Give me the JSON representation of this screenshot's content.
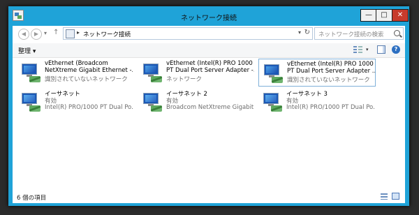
{
  "window": {
    "title": "ネットワーク接続",
    "min_label": "—",
    "max_label": "□",
    "close_label": "✕"
  },
  "nav": {
    "back_label": "◀",
    "forward_label": "▶",
    "recent_label": "▾",
    "up_label": "↑",
    "address_sep": "▸",
    "address": "ネットワーク接続",
    "address_dropdown": "▾",
    "refresh_label": "↻",
    "search_placeholder": "ネットワーク接続の検索"
  },
  "toolbar": {
    "organize_label": "整理 ▾",
    "view_dropdown": "▾",
    "help_label": "?"
  },
  "connections": [
    {
      "name_line1": "vEthernet (Broadcom",
      "name_line2": "NetXtreme Gigabit Ethernet -...",
      "status": "識別されていないネットワーク",
      "icon": "network-adapter-icon",
      "disconnected": false,
      "selected": false
    },
    {
      "name_line1": "vEthernet (Intel(R) PRO 1000",
      "name_line2": "PT Dual Port Server Adapter -...",
      "status": "ネットワーク",
      "icon": "network-adapter-icon",
      "disconnected": false,
      "selected": false
    },
    {
      "name_line1": "vEthernet (Intel(R) PRO 1000",
      "name_line2": "PT Dual Port Server Adapter ...",
      "status": "識別されていないネットワーク",
      "icon": "network-adapter-icon",
      "disconnected": false,
      "selected": true
    },
    {
      "name_line1": "イーサネット",
      "name_line2": "有効",
      "status": "Intel(R) PRO/1000 PT Dual Po...",
      "icon": "network-adapter-disabled-icon",
      "disconnected": false,
      "selected": false
    },
    {
      "name_line1": "イーサネット 2",
      "name_line2": "有効",
      "status": "Broadcom NetXtreme Gigabit...",
      "icon": "network-adapter-disabled-icon",
      "disconnected": false,
      "selected": false
    },
    {
      "name_line1": "イーサネット 3",
      "name_line2": "有効",
      "status": "Intel(R) PRO/1000 PT Dual Po...",
      "icon": "network-adapter-disabled-icon",
      "disconnected": false,
      "selected": false
    }
  ],
  "statusbar": {
    "item_count": "6 個の項目"
  },
  "colors": {
    "window_frame": "#1fa3d8",
    "selection_border": "#7fb0d9",
    "close_button": "#c73b2c"
  }
}
